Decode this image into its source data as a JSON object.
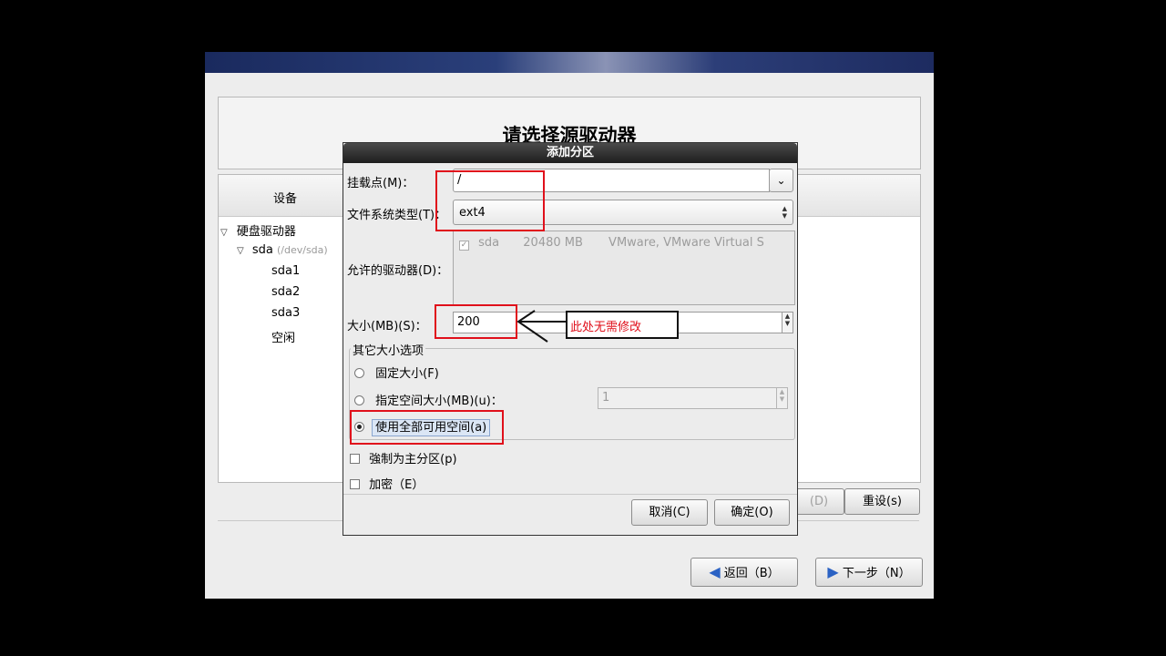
{
  "installer": {
    "page_title": "请选择源驱动器",
    "device_column": "设备",
    "tree": {
      "root": "硬盘驱动器",
      "disk": "sda",
      "disk_path": "(/dev/sda)",
      "partitions": [
        "sda1",
        "sda2",
        "sda3",
        "空闲"
      ]
    },
    "buttons": {
      "delete_partial": "(D)",
      "reset": "重设(s)",
      "back": "返回（B）",
      "next": "下一步（N）"
    }
  },
  "dialog": {
    "title": "添加分区",
    "mount_label": "挂载点(M)：",
    "mount_value": "/",
    "fs_label": "文件系统类型(T)：",
    "fs_value": "ext4",
    "drives_label": "允许的驱动器(D)：",
    "drive_row": {
      "name": "sda",
      "size": "20480 MB",
      "model": "VMware, VMware Virtual S"
    },
    "size_label": "大小(MB)(S)：",
    "size_value": "200",
    "annotation": "此处无需修改",
    "other_options_label": "其它大小选项",
    "opt_fixed": "固定大小(F)",
    "opt_upto": "指定空间大小(MB)(u)：",
    "opt_upto_value": "1",
    "opt_fill": "使用全部可用空间(a)",
    "force_primary": "強制为主分区(p)",
    "encrypt": "加密（E）",
    "cancel": "取消(C)",
    "ok": "确定(O)"
  },
  "colors": {
    "annotation_red": "#e0101b",
    "title_bar": "#2a2a2a",
    "banner": "#2a3f7a"
  }
}
